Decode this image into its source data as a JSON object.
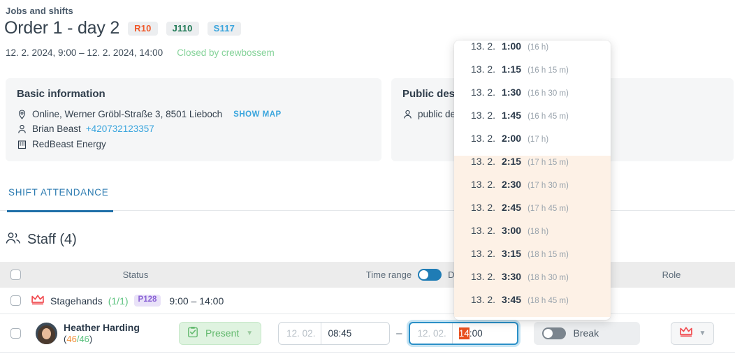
{
  "header": {
    "breadcrumb": "Jobs and shifts",
    "title": "Order 1 - day 2",
    "badges": [
      {
        "label": "R10",
        "color": "#f0592a"
      },
      {
        "label": "J110",
        "color": "#1f7a56"
      },
      {
        "label": "S117",
        "color": "#3aa5dd"
      }
    ],
    "daterange": "12. 2. 2024, 9:00 – 12. 2. 2024, 14:00",
    "status": "Closed by crewbossem"
  },
  "basic_card": {
    "title": "Basic information",
    "location": "Online, Werner Gröbl-Straße 3, 8501 Lieboch",
    "show_map": "SHOW MAP",
    "contact_name": "Brian Beast",
    "contact_phone": "+420732123357",
    "company": "RedBeast Energy"
  },
  "public_card": {
    "title": "Public description",
    "line": "public description"
  },
  "tabs": [
    {
      "label": "SHIFT ATTENDANCE",
      "active": true
    }
  ],
  "staff": {
    "heading": "Staff (4)",
    "columns": {
      "status": "Status",
      "time_range": "Time range",
      "duration": "Duration",
      "role": "Role"
    },
    "group_row": {
      "name": "Stagehands",
      "count": "(1/1)",
      "badge": "P128",
      "time": "9:00 – 14:00"
    },
    "member_row": {
      "name": "Heather Harding",
      "count_filled": "46",
      "count_sep": "/",
      "count_total": "46",
      "status_label": "Present",
      "start_date": "12. 02.",
      "start_time": "08:45",
      "separator": "–",
      "end_date": "12. 02.",
      "end_time_selected": "14",
      "end_time_rest": ":00",
      "break_label": "Break"
    }
  },
  "dropdown": {
    "items": [
      {
        "date": "13. 2.",
        "time": "1:00",
        "duration": "(16 h)",
        "highlight": false
      },
      {
        "date": "13. 2.",
        "time": "1:15",
        "duration": "(16 h 15 m)",
        "highlight": false
      },
      {
        "date": "13. 2.",
        "time": "1:30",
        "duration": "(16 h 30 m)",
        "highlight": false
      },
      {
        "date": "13. 2.",
        "time": "1:45",
        "duration": "(16 h 45 m)",
        "highlight": false
      },
      {
        "date": "13. 2.",
        "time": "2:00",
        "duration": "(17 h)",
        "highlight": false
      },
      {
        "date": "13. 2.",
        "time": "2:15",
        "duration": "(17 h 15 m)",
        "highlight": true
      },
      {
        "date": "13. 2.",
        "time": "2:30",
        "duration": "(17 h 30 m)",
        "highlight": true
      },
      {
        "date": "13. 2.",
        "time": "2:45",
        "duration": "(17 h 45 m)",
        "highlight": true
      },
      {
        "date": "13. 2.",
        "time": "3:00",
        "duration": "(18 h)",
        "highlight": true
      },
      {
        "date": "13. 2.",
        "time": "3:15",
        "duration": "(18 h 15 m)",
        "highlight": true
      },
      {
        "date": "13. 2.",
        "time": "3:30",
        "duration": "(18 h 30 m)",
        "highlight": true
      },
      {
        "date": "13. 2.",
        "time": "3:45",
        "duration": "(18 h 45 m)",
        "highlight": true
      }
    ]
  },
  "colors": {
    "accent_blue": "#2a7ab0",
    "selection_orange": "#e8501f",
    "crown_red": "#f14d52",
    "present_green": "#63b96e",
    "highlight_row": "#fdf1e6"
  }
}
